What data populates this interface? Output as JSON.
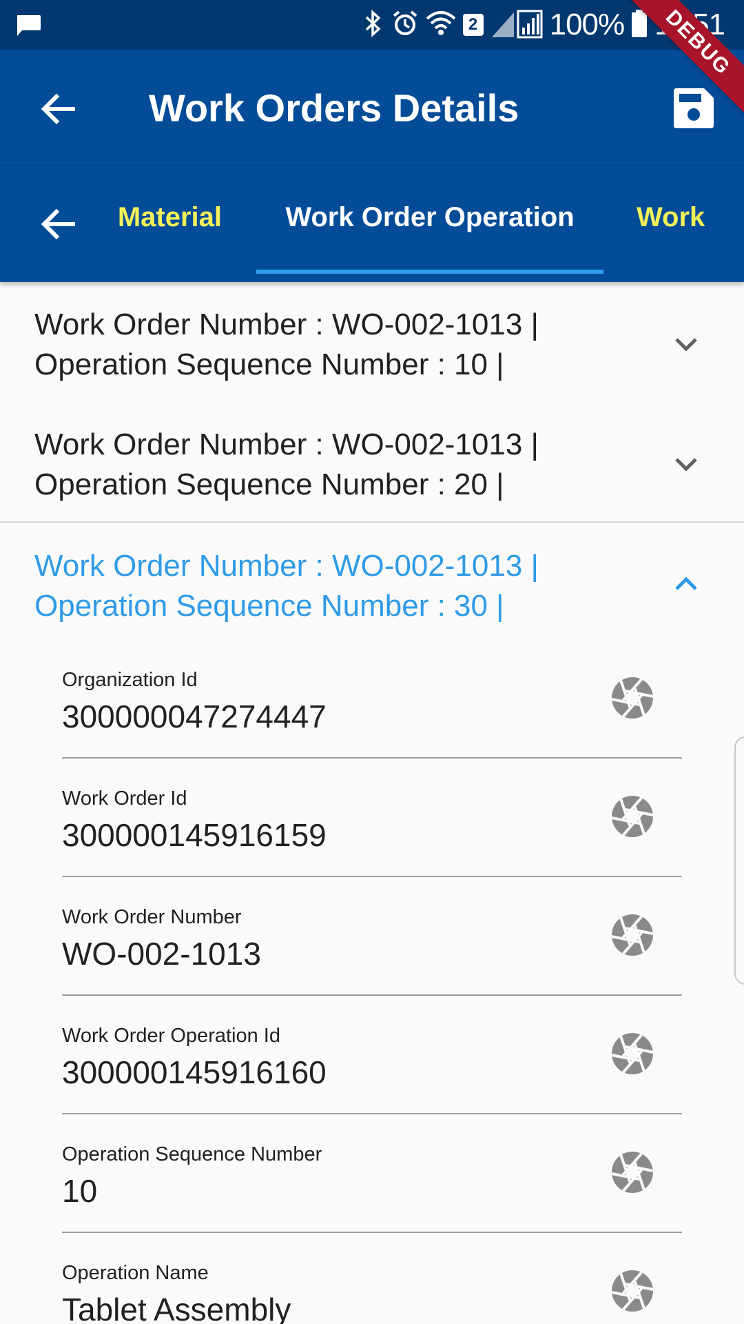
{
  "status_bar": {
    "battery": "100%",
    "time": "11:51",
    "sim_badge": "2",
    "icons": [
      "message-icon",
      "bluetooth-icon",
      "alarm-icon",
      "wifi-icon",
      "signal-icon",
      "battery-icon"
    ]
  },
  "debug_banner": "DEBUG",
  "app_bar": {
    "title": "Work Orders Details",
    "back_icon": "arrow-back-icon",
    "save_icon": "save-icon"
  },
  "tabs": {
    "back_icon": "arrow-back-icon",
    "items": [
      {
        "label": "Material"
      },
      {
        "label": "Work Order Operation"
      },
      {
        "label": "Work"
      }
    ],
    "active_index": 1
  },
  "colors": {
    "status_bar": "#03376f",
    "app_bar": "#044c98",
    "active_tab_indicator": "#2f9df0",
    "inactive_tab_text": "#f3f05a",
    "expanded_title": "#2f9be8"
  },
  "operations": [
    {
      "title": "Work Order Number : WO-002-1013 | Operation Sequence Number : 10 |",
      "expanded": false
    },
    {
      "title": "Work Order Number : WO-002-1013 | Operation Sequence Number : 20 |",
      "expanded": false
    },
    {
      "title": "Work Order Number : WO-002-1013 | Operation Sequence Number : 30 |",
      "expanded": true
    }
  ],
  "fields": [
    {
      "label": "Organization Id",
      "value": "300000047274447"
    },
    {
      "label": "Work Order Id",
      "value": "300000145916159"
    },
    {
      "label": "Work Order Number",
      "value": "WO-002-1013"
    },
    {
      "label": "Work Order Operation Id",
      "value": "300000145916160"
    },
    {
      "label": "Operation Sequence Number",
      "value": "10"
    },
    {
      "label": "Operation Name",
      "value": "Tablet Assembly"
    }
  ]
}
